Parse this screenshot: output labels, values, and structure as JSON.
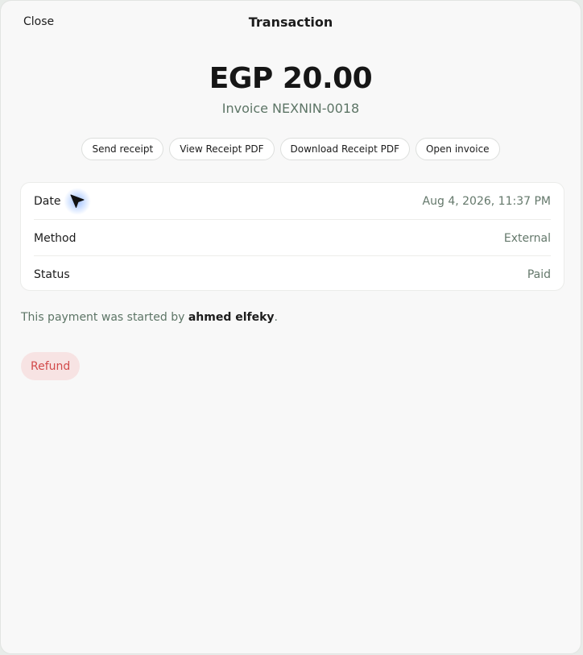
{
  "header": {
    "close_label": "Close",
    "title": "Transaction"
  },
  "summary": {
    "amount": "EGP 20.00",
    "invoice": "Invoice NEXNIN-0018"
  },
  "actions": [
    {
      "label": "Send receipt"
    },
    {
      "label": "View Receipt PDF"
    },
    {
      "label": "Download Receipt PDF"
    },
    {
      "label": "Open invoice"
    }
  ],
  "details": {
    "rows": [
      {
        "label": "Date",
        "value": "Aug 4, 2026, 11:37 PM"
      },
      {
        "label": "Method",
        "value": "External"
      },
      {
        "label": "Status",
        "value": "Paid"
      }
    ]
  },
  "note": {
    "prefix": "This payment was started by ",
    "user": "ahmed elfeky",
    "suffix": "."
  },
  "refund": {
    "label": "Refund"
  },
  "colors": {
    "accent_text": "#5d7566",
    "refund_bg": "#f7e3e3",
    "refund_text": "#d24a4a"
  },
  "icons": {
    "cursor": "mouse-pointer-icon"
  }
}
